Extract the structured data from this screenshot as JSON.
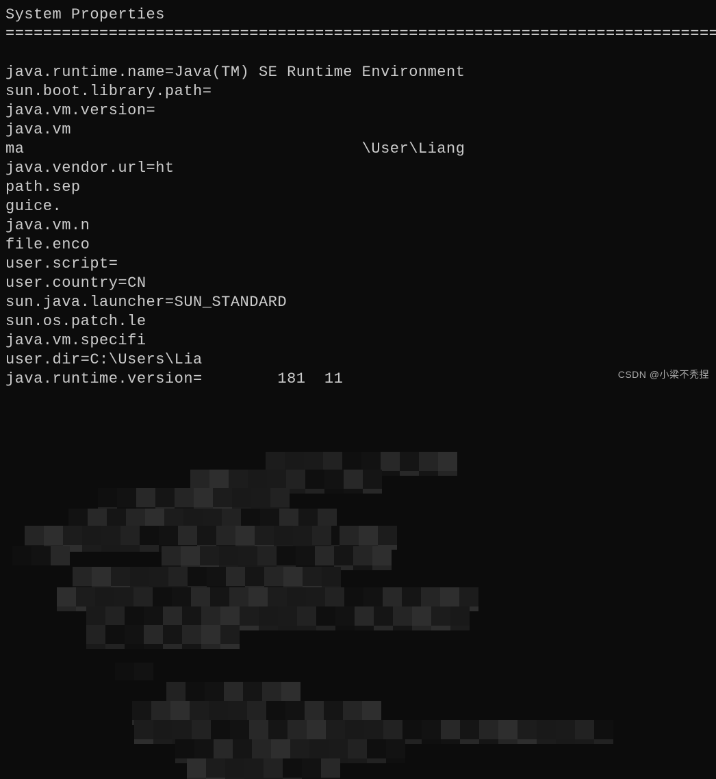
{
  "header": {
    "title": "System Properties",
    "divider": "==========================================================================================="
  },
  "lines": {
    "l0": "java.runtime.name=Java(TM) SE Runtime Environment",
    "l1": "sun.boot.library.path=",
    "l2": "java.vm.version=",
    "l3": "java.vm",
    "l4": "ma                                    \\User\\Liang",
    "l5": "java.vendor.url=ht",
    "l6": "path.sep",
    "l7": "guice.",
    "l8": "java.vm.n",
    "l9": "file.enco",
    "l10": "user.script=",
    "l11": "user.country=CN",
    "l12": "sun.java.launcher=SUN_STANDARD",
    "l13": "sun.os.patch.le",
    "l14": "java.vm.specifi",
    "l15": "user.dir=C:\\Users\\Lia",
    "l16": "java.runtime.version=        181  11"
  },
  "watermark": {
    "text": "CSDN @小梁不秃捏"
  }
}
